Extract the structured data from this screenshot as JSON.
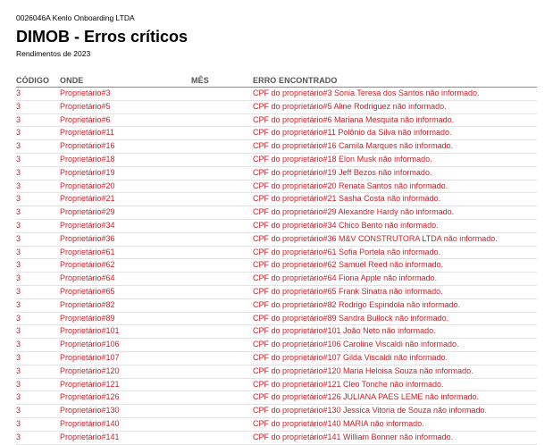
{
  "report": {
    "company": "0026046A Kenlo Onboarding LTDA",
    "title": "DIMOB - Erros críticos",
    "subtitle": "Rendimentos de 2023"
  },
  "table": {
    "headers": [
      "CÓDIGO",
      "ONDE",
      "MÊS",
      "ERRO ENCONTRADO"
    ],
    "rows": [
      {
        "codigo": "3",
        "onde": "Proprietário#3",
        "mes": "",
        "erro": "CPF do proprietário#3 Sonia Teresa dos Santos não informado."
      },
      {
        "codigo": "3",
        "onde": "Proprietário#5",
        "mes": "",
        "erro": "CPF do proprietário#5 Aline Rodriguez não informado."
      },
      {
        "codigo": "3",
        "onde": "Proprietário#6",
        "mes": "",
        "erro": "CPF do proprietário#6 Mariana Mesquita não informado."
      },
      {
        "codigo": "3",
        "onde": "Proprietário#11",
        "mes": "",
        "erro": "CPF do proprietário#11 Polônio da Silva não informado."
      },
      {
        "codigo": "3",
        "onde": "Proprietário#16",
        "mes": "",
        "erro": "CPF do proprietário#16 Camila Marques não informado."
      },
      {
        "codigo": "3",
        "onde": "Proprietário#18",
        "mes": "",
        "erro": "CPF do proprietário#18 Elon Musk não informado."
      },
      {
        "codigo": "3",
        "onde": "Proprietário#19",
        "mes": "",
        "erro": "CPF do proprietário#19 Jeff Bezos não informado."
      },
      {
        "codigo": "3",
        "onde": "Proprietário#20",
        "mes": "",
        "erro": "CPF do proprietário#20 Renata Santos não informado."
      },
      {
        "codigo": "3",
        "onde": "Proprietário#21",
        "mes": "",
        "erro": "CPF do proprietário#21 Sasha Costa não informado."
      },
      {
        "codigo": "3",
        "onde": "Proprietário#29",
        "mes": "",
        "erro": "CPF do proprietário#29 Alexandre Hardy não informado."
      },
      {
        "codigo": "3",
        "onde": "Proprietário#34",
        "mes": "",
        "erro": "CPF do proprietário#34 Chico Bento não informado."
      },
      {
        "codigo": "3",
        "onde": "Proprietário#36",
        "mes": "",
        "erro": "CPF do proprietário#36 M&V CONSTRUTORA LTDA não informado."
      },
      {
        "codigo": "3",
        "onde": "Proprietário#61",
        "mes": "",
        "erro": "CPF do proprietário#61 Sofia Portela não informado."
      },
      {
        "codigo": "3",
        "onde": "Proprietário#62",
        "mes": "",
        "erro": "CPF do proprietário#62 Samuel Reed não informado."
      },
      {
        "codigo": "3",
        "onde": "Proprietário#64",
        "mes": "",
        "erro": "CPF do proprietário#64 Fiona Apple não informado."
      },
      {
        "codigo": "3",
        "onde": "Proprietário#65",
        "mes": "",
        "erro": "CPF do proprietário#65 Frank Sinatra não informado."
      },
      {
        "codigo": "3",
        "onde": "Proprietário#82",
        "mes": "",
        "erro": "CPF do proprietário#82 Rodrigo Espindola não informado."
      },
      {
        "codigo": "3",
        "onde": "Proprietário#89",
        "mes": "",
        "erro": "CPF do proprietário#89 Sandra Bullock não informado."
      },
      {
        "codigo": "3",
        "onde": "Proprietário#101",
        "mes": "",
        "erro": "CPF do proprietário#101 João Neto não informado."
      },
      {
        "codigo": "3",
        "onde": "Proprietário#106",
        "mes": "",
        "erro": "CPF do proprietário#106 Caroline Viscaldi não informado."
      },
      {
        "codigo": "3",
        "onde": "Proprietário#107",
        "mes": "",
        "erro": "CPF do proprietário#107 Gilda Viscaldi não informado."
      },
      {
        "codigo": "3",
        "onde": "Proprietário#120",
        "mes": "",
        "erro": "CPF do proprietário#120 Maria Heloisa Souza não informado."
      },
      {
        "codigo": "3",
        "onde": "Proprietário#121",
        "mes": "",
        "erro": "CPF do proprietário#121 Cleo Tonche não informado."
      },
      {
        "codigo": "3",
        "onde": "Proprietário#126",
        "mes": "",
        "erro": "CPF do proprietário#126 JULIANA PAES LEME não informado."
      },
      {
        "codigo": "3",
        "onde": "Proprietário#130",
        "mes": "",
        "erro": "CPF do proprietário#130 Jessica Vitoria de Souza não informado."
      },
      {
        "codigo": "3",
        "onde": "Proprietário#140",
        "mes": "",
        "erro": "CPF do proprietário#140 MARIA não informado."
      },
      {
        "codigo": "3",
        "onde": "Proprietário#141",
        "mes": "",
        "erro": "CPF do proprietário#141 William Bonner não informado."
      }
    ]
  }
}
